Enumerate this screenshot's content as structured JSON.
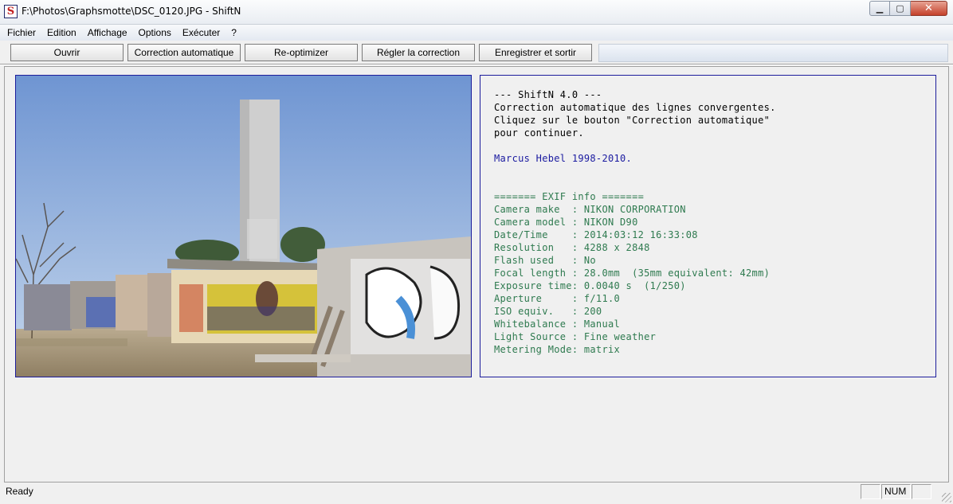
{
  "window": {
    "title": "F:\\Photos\\Graphsmotte\\DSC_0120.JPG - ShiftN",
    "app_icon_letter": "S",
    "minimize_glyph": "▁",
    "maximize_glyph": "▢",
    "close_glyph": "✕"
  },
  "menu": {
    "items": [
      "Fichier",
      "Edition",
      "Affichage",
      "Options",
      "Exécuter",
      "?"
    ]
  },
  "toolbar": {
    "open_label": "Ouvrir",
    "auto_correct_label": "Correction automatique",
    "reoptimize_label": "Re-optimizer",
    "adjust_label": "Régler la correction",
    "save_exit_label": "Enregistrer et sortir"
  },
  "info_panel": {
    "lines": [
      {
        "text": "--- ShiftN 4.0 ---",
        "color": "black"
      },
      {
        "text": "Correction automatique des lignes convergentes.",
        "color": "black"
      },
      {
        "text": "Cliquez sur le bouton \"Correction automatique\"",
        "color": "black"
      },
      {
        "text": "pour continuer.",
        "color": "black"
      },
      {
        "text": "",
        "color": "black"
      },
      {
        "text": "Marcus Hebel 1998-2010.",
        "color": "blue"
      },
      {
        "text": "",
        "color": "black"
      },
      {
        "text": "",
        "color": "black"
      },
      {
        "text": "======= EXIF info =======",
        "color": "green"
      },
      {
        "text": "Camera make  : NIKON CORPORATION",
        "color": "green"
      },
      {
        "text": "Camera model : NIKON D90",
        "color": "green"
      },
      {
        "text": "Date/Time    : 2014:03:12 16:33:08",
        "color": "green"
      },
      {
        "text": "Resolution   : 4288 x 2848",
        "color": "green"
      },
      {
        "text": "Flash used   : No",
        "color": "green"
      },
      {
        "text": "Focal length : 28.0mm  (35mm equivalent: 42mm)",
        "color": "green"
      },
      {
        "text": "Exposure time: 0.0040 s  (1/250)",
        "color": "green"
      },
      {
        "text": "Aperture     : f/11.0",
        "color": "green"
      },
      {
        "text": "ISO equiv.   : 200",
        "color": "green"
      },
      {
        "text": "Whitebalance : Manual",
        "color": "green"
      },
      {
        "text": "Light Source : Fine weather",
        "color": "green"
      },
      {
        "text": "Metering Mode: matrix",
        "color": "green"
      }
    ]
  },
  "status": {
    "text": "Ready",
    "num_indicator": "NUM"
  },
  "colors": {
    "panel_border": "#1d1d9c",
    "info_black": "#000000",
    "info_blue": "#1a1aa0",
    "info_green": "#2e7a4f"
  }
}
